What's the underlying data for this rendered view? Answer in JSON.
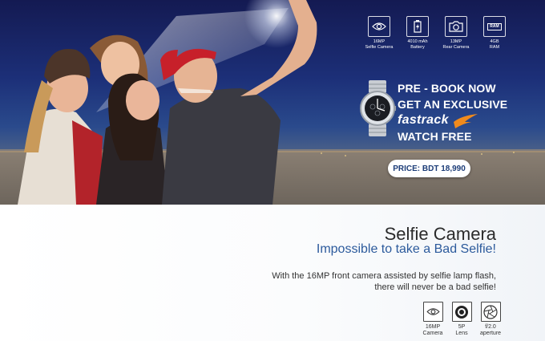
{
  "hero": {
    "specs": [
      {
        "icon": "eye-camera-icon",
        "line1": "16MP",
        "line2": "Selfie Camera"
      },
      {
        "icon": "battery-icon",
        "line1": "4010 mAh",
        "line2": "Battery"
      },
      {
        "icon": "camera-icon",
        "line1": "13MP",
        "line2": "Rear Camera"
      },
      {
        "icon": "ram-chip-icon",
        "chip_text": "RAM",
        "line1": "4GB",
        "line2": "RAM"
      }
    ],
    "promo": {
      "line1": "PRE - BOOK NOW",
      "line2": "GET AN EXCLUSIVE",
      "brand": "fastrack",
      "line4": "WATCH FREE"
    },
    "price": "PRICE: BDT 18,990"
  },
  "feature": {
    "title": "Selfie Camera",
    "subtitle": "Impossible to take a Bad Selfie!",
    "description_line1": "With the 16MP front camera assisted by selfie lamp flash,",
    "description_line2": "there will never be a bad selfie!",
    "badges": [
      {
        "icon": "eye-camera-icon",
        "line1": "16MP",
        "line2": "Camera"
      },
      {
        "icon": "lens-icon",
        "line1": "5P",
        "line2": "Lens"
      },
      {
        "icon": "aperture-icon",
        "line1": "f/2.0",
        "line2": "aperture"
      }
    ]
  },
  "colors": {
    "hero_top": "#141a52",
    "price_text": "#1d3d78",
    "subtitle": "#2c5a9c",
    "brand_accent": "#f08a1c"
  }
}
